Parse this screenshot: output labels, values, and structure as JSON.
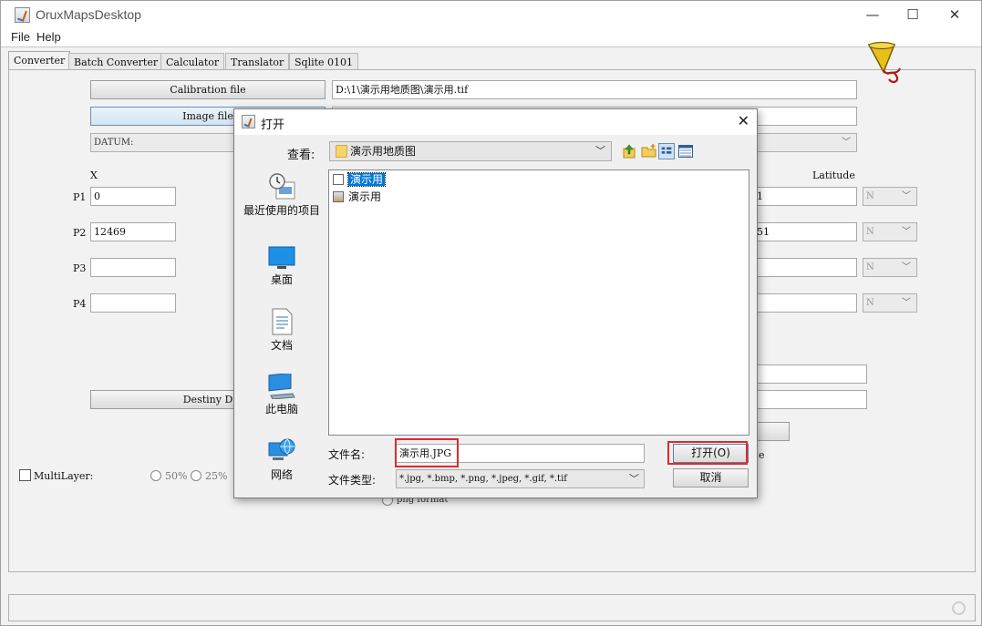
{
  "window": {
    "title": "OruxMapsDesktop",
    "controls": {
      "minimize": "—",
      "maximize": "☐",
      "close": "✕"
    }
  },
  "menu": [
    "File",
    "Help"
  ],
  "tabs": [
    "Converter",
    "Batch Converter",
    "Calculator",
    "Translator",
    "Sqlite 0101"
  ],
  "converter": {
    "calibration_button": "Calibration file",
    "calibration_path": "D:\\1\\演示用地质图\\演示用.tif",
    "image_button": "Image file",
    "datum_label": "DATUM:",
    "x_header": "X",
    "latitude_header": "Latitude",
    "rows": [
      {
        "label": "P1",
        "x": "0",
        "lat": "1",
        "hemi": "N"
      },
      {
        "label": "P2",
        "x": "12469",
        "lat": "51",
        "hemi": "N"
      },
      {
        "label": "P3",
        "x": "",
        "lat": "",
        "hemi": "N"
      },
      {
        "label": "P4",
        "x": "",
        "lat": "",
        "hemi": "N"
      }
    ],
    "destiny_button": "Destiny D",
    "multilayer_label": "MultiLayer:",
    "scales": [
      "50%",
      "25%"
    ],
    "png_format_label": "png format",
    "clipped_right_char": "e"
  },
  "dialog": {
    "title": "打开",
    "close_glyph": "✕",
    "look_in_label": "查看:",
    "look_in_value": "演示用地质图",
    "places": [
      "最近使用的项目",
      "桌面",
      "文档",
      "此电脑",
      "网络"
    ],
    "files": [
      {
        "name": "演示用",
        "selected": true,
        "kind": "file"
      },
      {
        "name": "演示用",
        "selected": false,
        "kind": "image"
      }
    ],
    "file_name_label": "文件名:",
    "file_name_value": "演示用.JPG",
    "file_type_label": "文件类型:",
    "file_type_value": "*.jpg, *.bmp, *.png, *.jpeg, *.gif, *.tif",
    "open_button": "打开(O)",
    "cancel_button": "取消"
  },
  "colors": {
    "highlight_box": "#e0282e",
    "selection": "#0078d7"
  }
}
